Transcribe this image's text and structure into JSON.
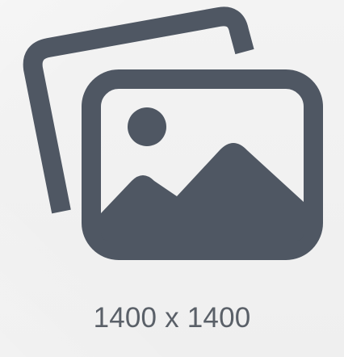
{
  "placeholder": {
    "icon_name": "image-gallery-placeholder-icon",
    "dimensions_text": "1400 x 1400",
    "colors": {
      "background": "#f1f1f1",
      "icon": "#4f5763",
      "text": "#5a6068"
    }
  }
}
